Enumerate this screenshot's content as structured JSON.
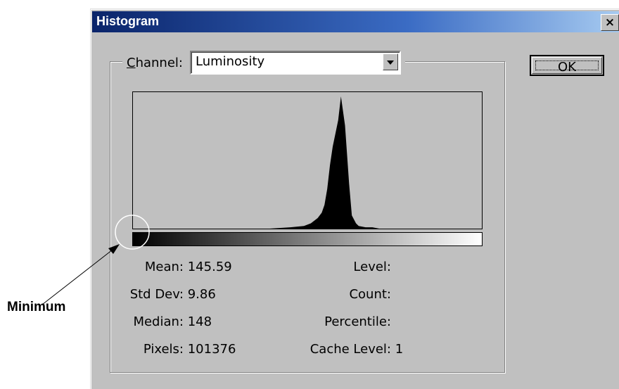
{
  "dialog": {
    "title": "Histogram",
    "close_glyph": "×",
    "ok_label": "OK"
  },
  "channel": {
    "label": "Channel:",
    "value": "Luminosity"
  },
  "stats_left": [
    {
      "key": "Mean:",
      "value": "145.59"
    },
    {
      "key": "Std Dev:",
      "value": "9.86"
    },
    {
      "key": "Median:",
      "value": "148"
    },
    {
      "key": "Pixels:",
      "value": "101376"
    }
  ],
  "stats_right": [
    {
      "key": "Level:",
      "value": ""
    },
    {
      "key": "Count:",
      "value": ""
    },
    {
      "key": "Percentile:",
      "value": ""
    },
    {
      "key": "Cache Level:",
      "value": "1"
    }
  ],
  "annotation": {
    "label": "Minimum"
  },
  "icons": {
    "close": "close-icon",
    "dropdown": "chevron-down-icon"
  },
  "colors": {
    "title_bar_start": "#0a246a",
    "title_bar_end": "#a6caf0",
    "dialog_bg": "#c0c0c0",
    "histogram_fill": "#000000"
  },
  "chart_data": {
    "type": "area",
    "xlim": [
      0,
      255
    ],
    "x": [
      0,
      100,
      115,
      125,
      130,
      135,
      138,
      140,
      142,
      144,
      146,
      148,
      150,
      152,
      155,
      158,
      160,
      163,
      165,
      170,
      175,
      180,
      255
    ],
    "values": [
      0,
      0,
      1,
      2,
      4,
      8,
      12,
      18,
      30,
      48,
      62,
      72,
      82,
      100,
      78,
      34,
      10,
      4,
      2,
      1,
      1,
      0,
      0
    ]
  }
}
